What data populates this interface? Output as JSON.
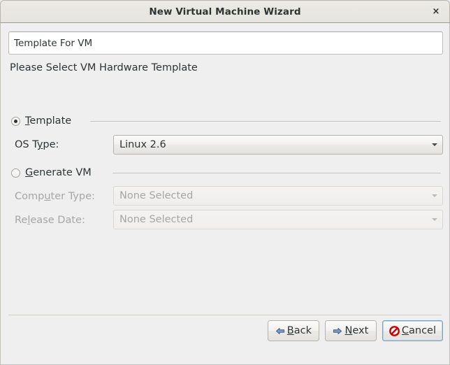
{
  "window": {
    "title": "New Virtual Machine Wizard",
    "close_label": "×",
    "close_icon": "close-icon"
  },
  "form": {
    "name_field": {
      "value": "Template For VM",
      "placeholder": ""
    },
    "heading": "Please Select VM Hardware Template",
    "template_group": {
      "radio_label_pre": "T",
      "radio_label_post": "emplate",
      "selected": true,
      "os_type": {
        "label_pre": "OS T",
        "label_mnemonic": "y",
        "label_post": "pe:",
        "value": "Linux 2.6",
        "enabled": true
      }
    },
    "generate_group": {
      "radio_label_pre": "G",
      "radio_label_post": "enerate VM",
      "selected": false,
      "computer_type": {
        "label_pre": "Comp",
        "label_mnemonic": "u",
        "label_post": "ter Type:",
        "value": "None Selected",
        "enabled": false
      },
      "release_date": {
        "label_pre": "Re",
        "label_mnemonic": "l",
        "label_post": "ease Date:",
        "value": "None Selected",
        "enabled": false
      }
    }
  },
  "actions": {
    "back": {
      "label_pre": "",
      "label_mnemonic": "B",
      "label_post": "ack",
      "icon": "arrow-left-icon"
    },
    "next": {
      "label_pre": "",
      "label_mnemonic": "N",
      "label_post": "ext",
      "icon": "arrow-right-icon"
    },
    "cancel": {
      "label_pre": "",
      "label_mnemonic": "C",
      "label_post": "ancel",
      "icon": "no-entry-icon",
      "focused": true
    }
  },
  "colors": {
    "window_bg": "#efefef",
    "titlebar_bg": "#e8e6e1",
    "text": "#2e3436",
    "disabled_text": "#a6a6a6",
    "accent_arrow": "#6f92bf",
    "cancel_icon": "#cc0000",
    "focus_border": "#7ba3c4"
  }
}
